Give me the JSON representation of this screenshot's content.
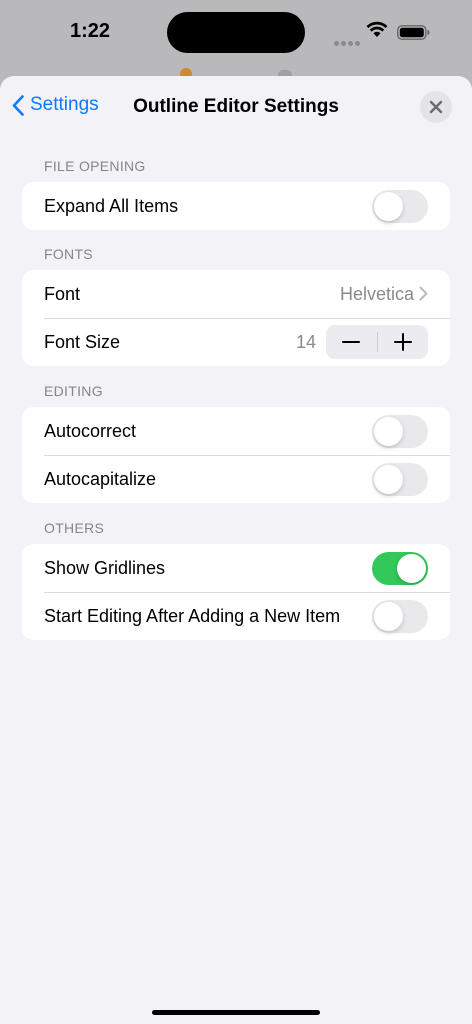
{
  "status": {
    "time": "1:22"
  },
  "nav": {
    "back_label": "Settings",
    "title": "Outline Editor Settings"
  },
  "sections": {
    "file_opening": {
      "header": "FILE OPENING",
      "expand_all_items": {
        "label": "Expand All Items",
        "on": false
      }
    },
    "fonts": {
      "header": "FONTS",
      "font": {
        "label": "Font",
        "value": "Helvetica"
      },
      "font_size": {
        "label": "Font Size",
        "value": "14",
        "minus": "−",
        "plus": "+"
      }
    },
    "editing": {
      "header": "EDITING",
      "autocorrect": {
        "label": "Autocorrect",
        "on": false
      },
      "autocapitalize": {
        "label": "Autocapitalize",
        "on": false
      }
    },
    "others": {
      "header": "OTHERS",
      "show_gridlines": {
        "label": "Show Gridlines",
        "on": true
      },
      "start_editing": {
        "label": "Start Editing After Adding a New Item",
        "on": false
      }
    }
  },
  "colors": {
    "accent": "#0a7aff",
    "toggle_on": "#34c759",
    "background": "#f2f2f7"
  }
}
